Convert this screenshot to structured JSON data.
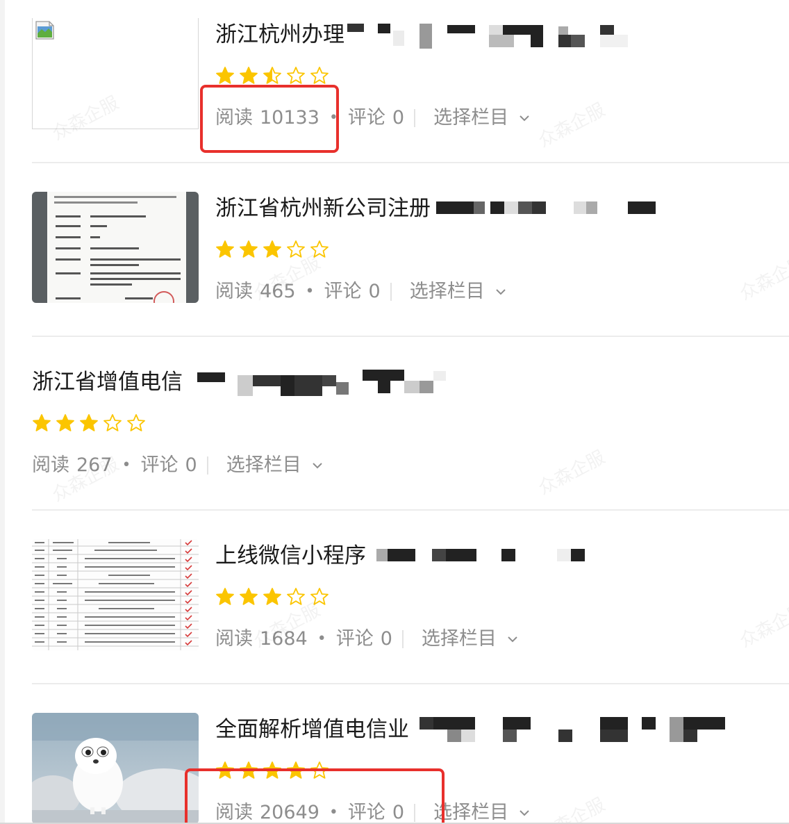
{
  "articles": [
    {
      "title": "浙江杭州办理",
      "rating": 2.5,
      "read_label": "阅读",
      "read_count": "10133",
      "comment_label": "评论",
      "comment_count": "0",
      "column_label": "选择栏目"
    },
    {
      "title": "浙江省杭州新公司注册",
      "rating": 3,
      "read_label": "阅读",
      "read_count": "465",
      "comment_label": "评论",
      "comment_count": "0",
      "column_label": "选择栏目"
    },
    {
      "title": "浙江省增值电信",
      "rating": 3,
      "read_label": "阅读",
      "read_count": "267",
      "comment_label": "评论",
      "comment_count": "0",
      "column_label": "选择栏目"
    },
    {
      "title": "上线微信小程序",
      "rating": 3,
      "read_label": "阅读",
      "read_count": "1684",
      "comment_label": "评论",
      "comment_count": "0",
      "column_label": "选择栏目"
    },
    {
      "title": "全面解析增值电信业",
      "rating": 4,
      "read_label": "阅读",
      "read_count": "20649",
      "comment_label": "评论",
      "comment_count": "0",
      "column_label": "选择栏目"
    }
  ],
  "watermark_text": "众森企服",
  "colors": {
    "star": "#fbc500",
    "highlight": "#e8302c",
    "meta_text": "#8d8d8d"
  },
  "icons": {
    "broken_image": "broken-image-icon",
    "star_full": "star-filled-icon",
    "star_half": "star-half-icon",
    "star_empty": "star-empty-icon",
    "dropdown": "chevron-down-icon"
  }
}
